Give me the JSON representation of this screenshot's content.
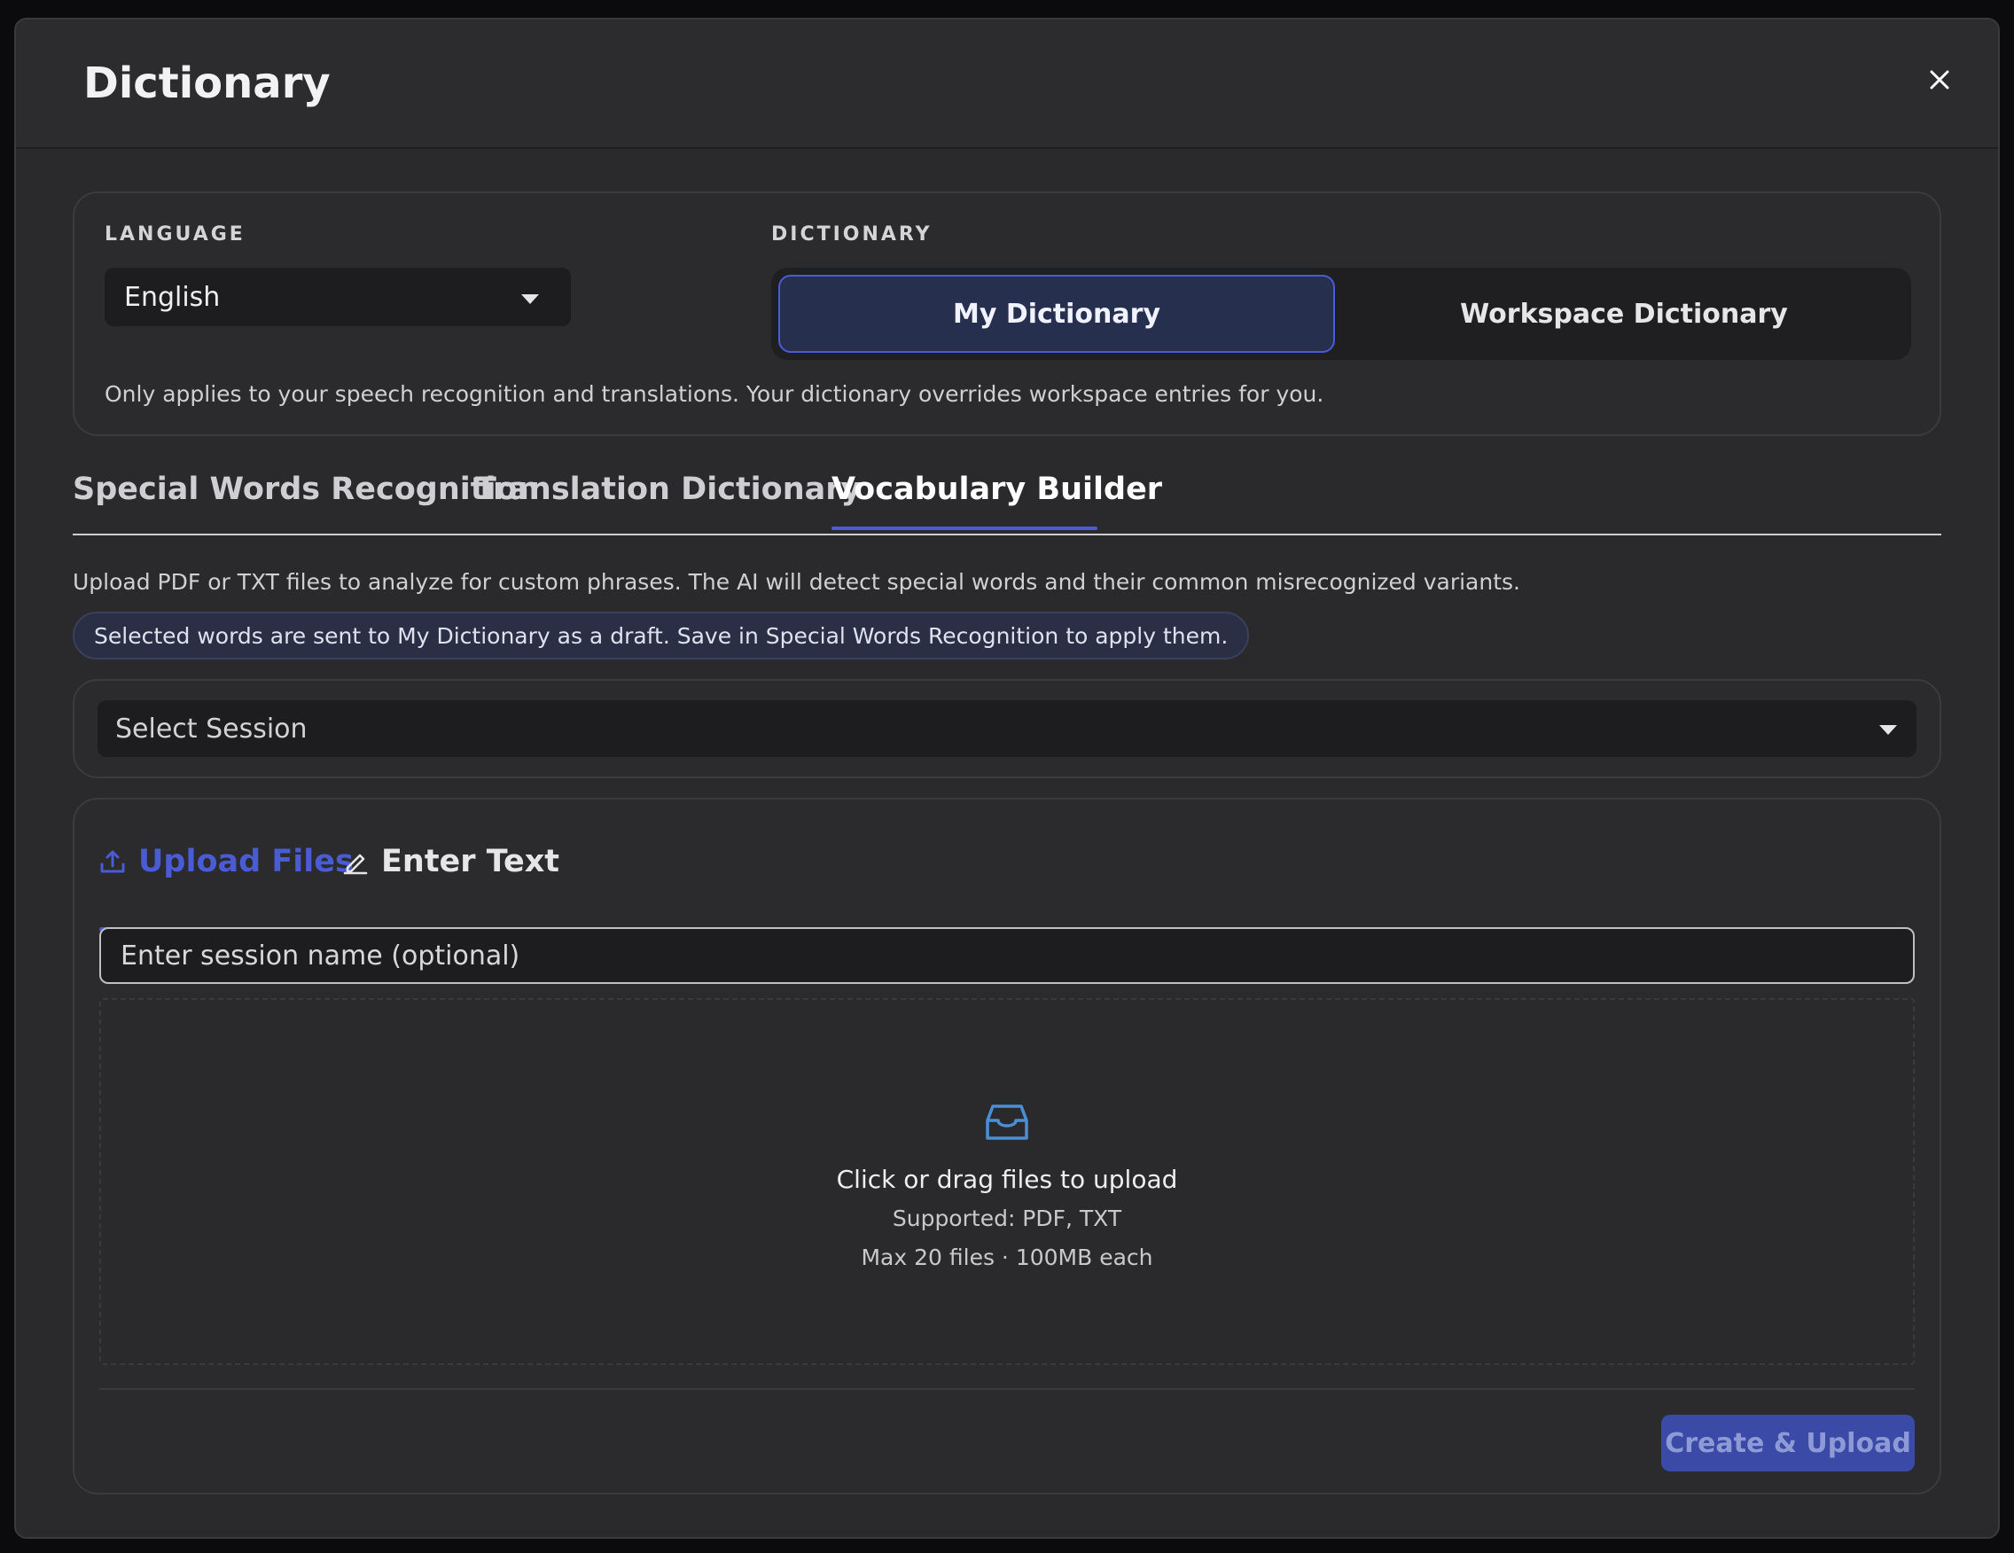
{
  "modal": {
    "title": "Dictionary"
  },
  "settings": {
    "language_label": "LANGUAGE",
    "language_value": "English",
    "dictionary_label": "DICTIONARY",
    "dictionary_options": [
      "My Dictionary",
      "Workspace Dictionary"
    ],
    "dictionary_selected": "My Dictionary",
    "note": "Only applies to your speech recognition and translations. Your dictionary overrides workspace entries for you."
  },
  "tabs": {
    "items": [
      "Special Words Recognition",
      "Translation Dictionary",
      "Vocabulary Builder"
    ],
    "active": "Vocabulary Builder"
  },
  "vocab": {
    "description": "Upload PDF or TXT files to analyze for custom phrases. The AI will detect special words and their common misrecognized variants.",
    "draft_note": "Selected words are sent to My Dictionary as a draft. Save in Special Words Recognition to apply them.",
    "session_select": "Select Session"
  },
  "upload": {
    "sub_tabs": [
      "Upload Files",
      "Enter Text"
    ],
    "active_sub_tab": "Upload Files",
    "session_name_placeholder": "Enter session name (optional)",
    "dropzone_title": "Click or drag files to upload",
    "dropzone_supported": "Supported: PDF, TXT",
    "dropzone_limits": "Max 20 files · 100MB each",
    "submit_label": "Create & Upload"
  },
  "colors": {
    "accent": "#4a5bd6",
    "background": "#2a2a2c",
    "button_disabled": "#3a4aa6"
  },
  "icons": {
    "close": "close-icon",
    "caret": "chevron-down-icon",
    "upload": "upload-icon",
    "edit": "pencil-icon",
    "inbox": "inbox-icon"
  }
}
